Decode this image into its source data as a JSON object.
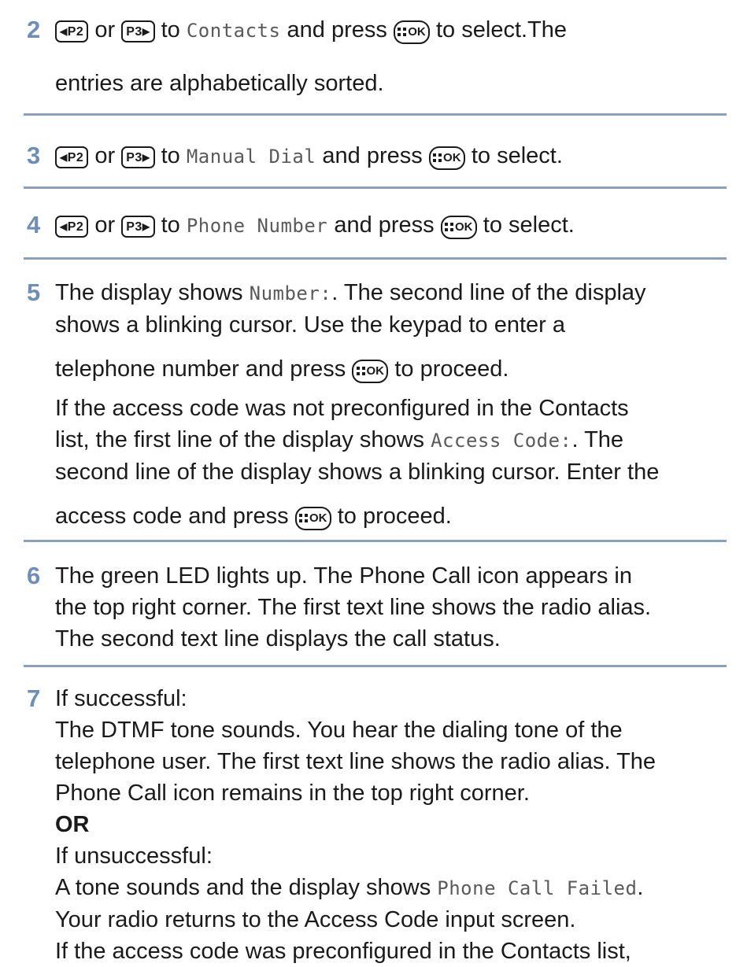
{
  "icons": {
    "p2": "P2",
    "p3": "P3",
    "ok": "OK"
  },
  "step2": {
    "num": "2",
    "or": "or",
    "to": "to",
    "target": "Contacts",
    "press": "and press",
    "tail": "to select.The",
    "line2": "entries are alphabetically sorted."
  },
  "step3": {
    "num": "3",
    "or": "or",
    "to": "to",
    "target": "Manual Dial",
    "press": "and press",
    "tail": "to select."
  },
  "step4": {
    "num": "4",
    "or": "or",
    "to": "to",
    "target": "Phone Number",
    "press": "and press",
    "tail": "to select."
  },
  "step5": {
    "num": "5",
    "l1a": "The display shows",
    "l1code": "Number:",
    "l1b": ". The second line of the display",
    "l2": "shows a blinking cursor. Use the keypad to enter a",
    "l3a": "telephone number and press",
    "l3b": "to proceed.",
    "l4": "If the access code was not preconfigured in the Contacts",
    "l5a": "list, the first line of the display shows",
    "l5code": "Access Code:",
    "l5b": ". The",
    "l6": "second line of the display shows a blinking cursor. Enter the",
    "l7a": "access code and press",
    "l7b": "to proceed."
  },
  "step6": {
    "num": "6",
    "l1": "The green LED lights up. The Phone Call icon appears in",
    "l2": "the top right corner. The first text line shows the radio alias.",
    "l3": "The second text line displays the call status."
  },
  "step7": {
    "num": "7",
    "l1": "If successful:",
    "l2": "The DTMF tone sounds. You hear the dialing tone of the",
    "l3": "telephone user. The first text line shows the radio alias. The",
    "l4": "Phone Call icon remains in the top right corner.",
    "or": "OR",
    "l5": "If unsuccessful:",
    "l6a": "A tone sounds and the display shows",
    "l6code": "Phone Call Failed",
    "l6b": ".",
    "l7": "Your radio returns to the Access Code input screen.",
    "l8": "If the access code was preconfigured in the Contacts list,"
  },
  "colors": {
    "step_number": "#6f8eb5",
    "rule": "#8aa0bd",
    "text": "#1a1a1a",
    "mono": "#5a5a5a"
  }
}
